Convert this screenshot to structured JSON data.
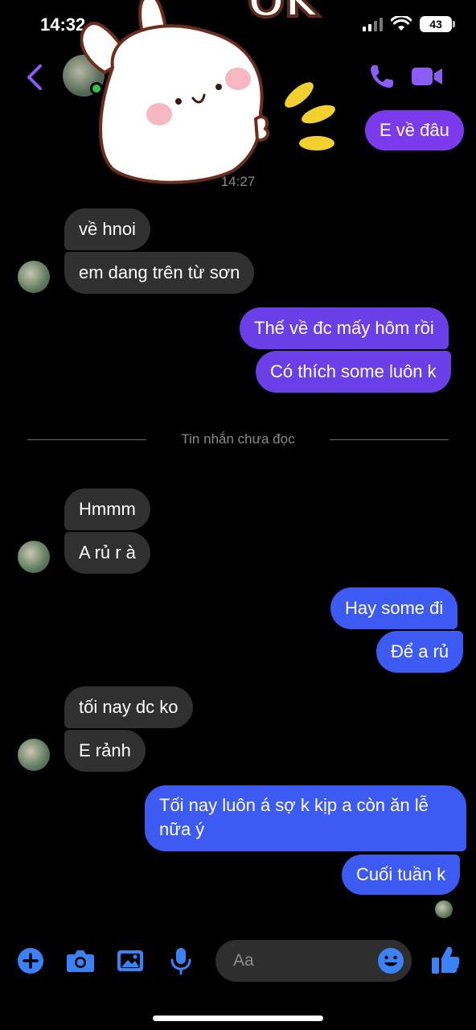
{
  "status_bar": {
    "time": "14:32",
    "battery": "43"
  },
  "header": {
    "contact_status": "online"
  },
  "sticker": {
    "text": "OK"
  },
  "timestamp": "14:27",
  "divider": {
    "label": "Tin nhắn chưa đọc"
  },
  "messages": [
    {
      "from": "me",
      "text": "E về đâu"
    },
    {
      "from": "them",
      "text": "về hnoi"
    },
    {
      "from": "them",
      "text": "em dang trên từ sơn"
    },
    {
      "from": "me",
      "text": "Thế về đc mấy hôm rồi"
    },
    {
      "from": "me",
      "text": "Có thích some luôn k"
    },
    {
      "from": "them",
      "text": "Hmmm"
    },
    {
      "from": "them",
      "text": "A rủ r à"
    },
    {
      "from": "me",
      "text": "Hay some đi"
    },
    {
      "from": "me",
      "text": "Để a rủ"
    },
    {
      "from": "them",
      "text": "tối nay dc ko"
    },
    {
      "from": "them",
      "text": "E rảnh"
    },
    {
      "from": "me",
      "text": "Tối nay luôn á sợ k kịp a còn ăn lễ nữa ý"
    },
    {
      "from": "me",
      "text": "Cuối tuần k"
    }
  ],
  "composer": {
    "placeholder": "Aa"
  },
  "colors": {
    "accent": "#7c3aed",
    "sent_blue": "#3d5bf2",
    "received": "#303030",
    "tool_icon": "#3b82f6"
  },
  "icons": [
    "back-chevron-icon",
    "phone-icon",
    "video-camera-icon",
    "plus-icon",
    "camera-icon",
    "image-icon",
    "microphone-icon",
    "emoji-icon",
    "thumbs-up-icon"
  ]
}
